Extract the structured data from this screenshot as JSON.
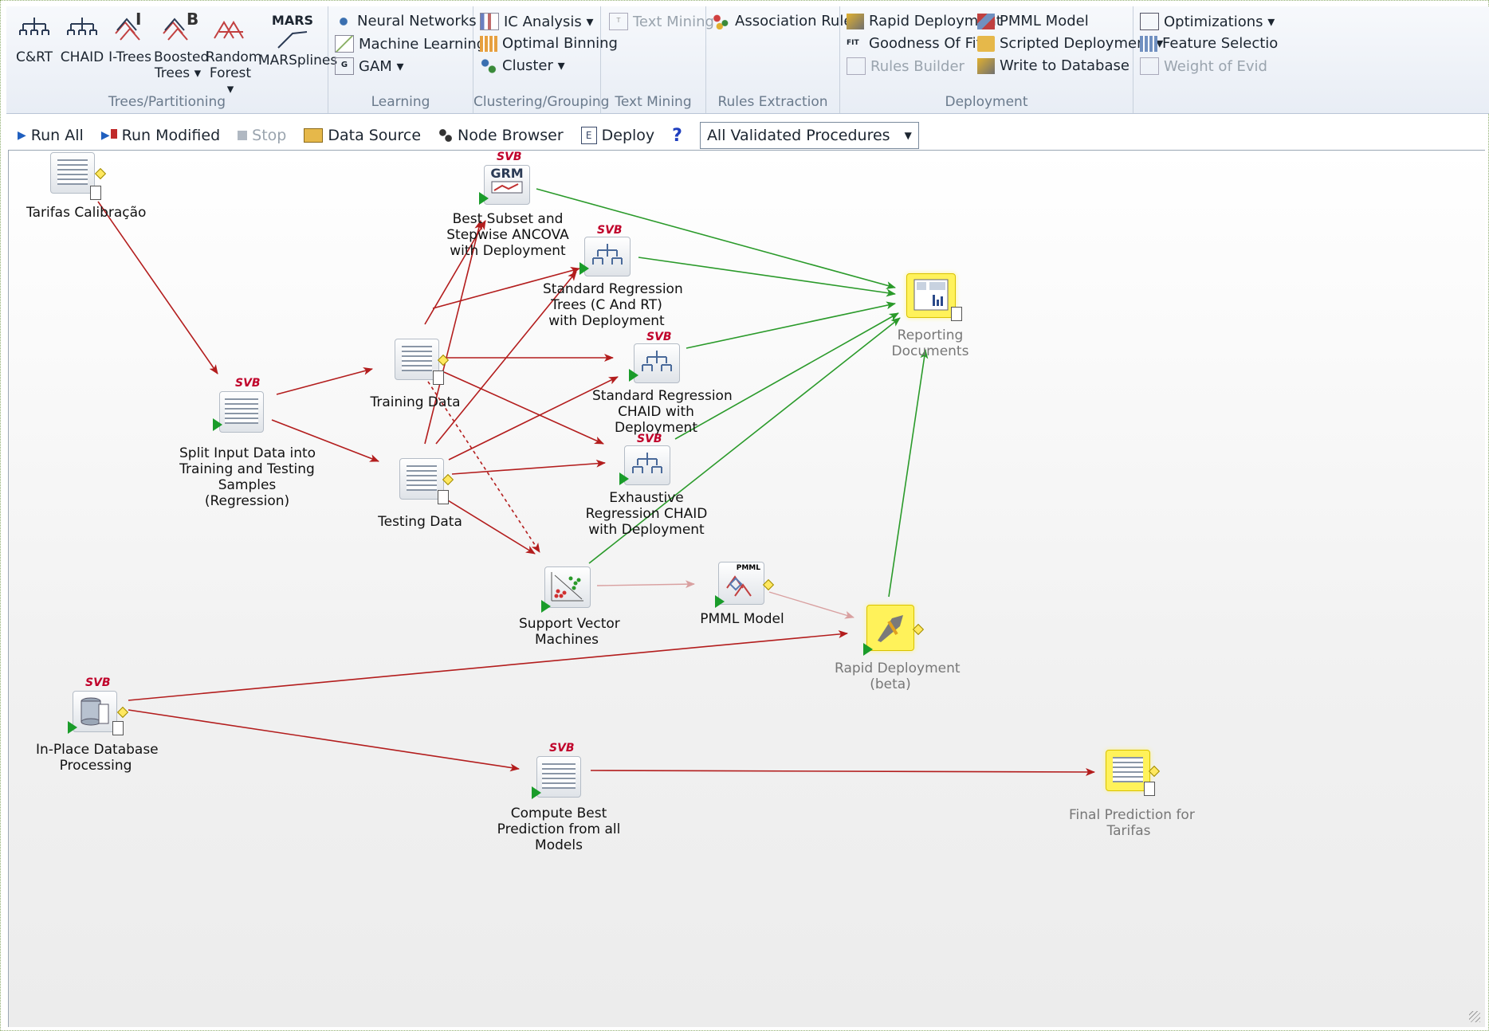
{
  "ribbon": {
    "trees_group": {
      "label": "Trees/Partitioning",
      "buttons": [
        {
          "label": "C&RT"
        },
        {
          "label": "CHAID"
        },
        {
          "label": "I-Trees"
        },
        {
          "label": "Boosted Trees ▾"
        },
        {
          "label": "Random Forest ▾"
        },
        {
          "label": "MARSplines"
        }
      ],
      "i_trees_badge": "I",
      "boosted_badge": "B",
      "mars_badge": "MARS"
    },
    "learning_group": {
      "label": "Learning",
      "items": [
        "Neural Networks ▾",
        "Machine Learning ▾",
        "GAM ▾"
      ]
    },
    "clustering_group": {
      "label": "Clustering/Grouping",
      "items": [
        "IC Analysis ▾",
        "Optimal Binning",
        "Cluster ▾"
      ]
    },
    "text_group": {
      "label": "Text Mining",
      "items": [
        "Text Mining"
      ]
    },
    "rules_group": {
      "label": "Rules Extraction",
      "items": [
        "Association Rules"
      ]
    },
    "deployment_group": {
      "label": "Deployment",
      "items": [
        "Rapid Deployment",
        "Goodness Of Fit ▾",
        "Rules Builder",
        "PMML Model",
        "Scripted Deployment ▾",
        "Write to Database"
      ]
    },
    "optim_group": {
      "items": [
        "Optimizations ▾",
        "Feature Selectio",
        "Weight of Evid"
      ]
    }
  },
  "toolbar": {
    "run_all": "Run All",
    "run_modified": "Run Modified",
    "stop": "Stop",
    "data_source": "Data Source",
    "node_browser": "Node Browser",
    "deploy": "Deploy",
    "help": "?",
    "procedures_value": "All Validated Procedures"
  },
  "nodes": {
    "tarifas": {
      "label": "Tarifas Calibração"
    },
    "split": {
      "label": [
        "Split Input Data into",
        "Training and Testing",
        "Samples",
        "(Regression)"
      ],
      "badge": "SVB"
    },
    "training": {
      "label": "Training Data"
    },
    "testing": {
      "label": "Testing Data"
    },
    "grm": {
      "label": [
        "Best Subset and",
        "Stepwise ANCOVA",
        "with Deployment"
      ],
      "badge": "SVB",
      "icon_text": "GRM"
    },
    "crt": {
      "label": [
        "Standard Regression",
        "Trees (C And RT)",
        "with Deployment"
      ],
      "badge": "SVB"
    },
    "chaid": {
      "label": [
        "Standard Regression",
        "CHAID with",
        "Deployment"
      ],
      "badge": "SVB"
    },
    "exchaid": {
      "label": [
        "Exhaustive",
        "Regression CHAID",
        "with Deployment"
      ],
      "badge": "SVB"
    },
    "svm": {
      "label": [
        "Support Vector",
        "Machines"
      ]
    },
    "pmml": {
      "label": "PMML Model",
      "icon_text": "PMML"
    },
    "reporting": {
      "label": [
        "Reporting",
        "Documents"
      ]
    },
    "rapid": {
      "label": [
        "Rapid Deployment",
        "(beta)"
      ]
    },
    "inplace": {
      "label": [
        "In-Place Database",
        "Processing"
      ],
      "badge": "SVB"
    },
    "compute": {
      "label": [
        "Compute Best",
        "Prediction from all",
        "Models"
      ],
      "badge": "SVB"
    },
    "final": {
      "label": [
        "Final Prediction for",
        "Tarifas"
      ]
    }
  },
  "colors": {
    "arrow_red": "#b31d1d",
    "arrow_green": "#2a9a2a",
    "arrow_pink": "#d9a0a0",
    "highlight_yellow": "#fff25a",
    "svb_red": "#c0002a"
  }
}
